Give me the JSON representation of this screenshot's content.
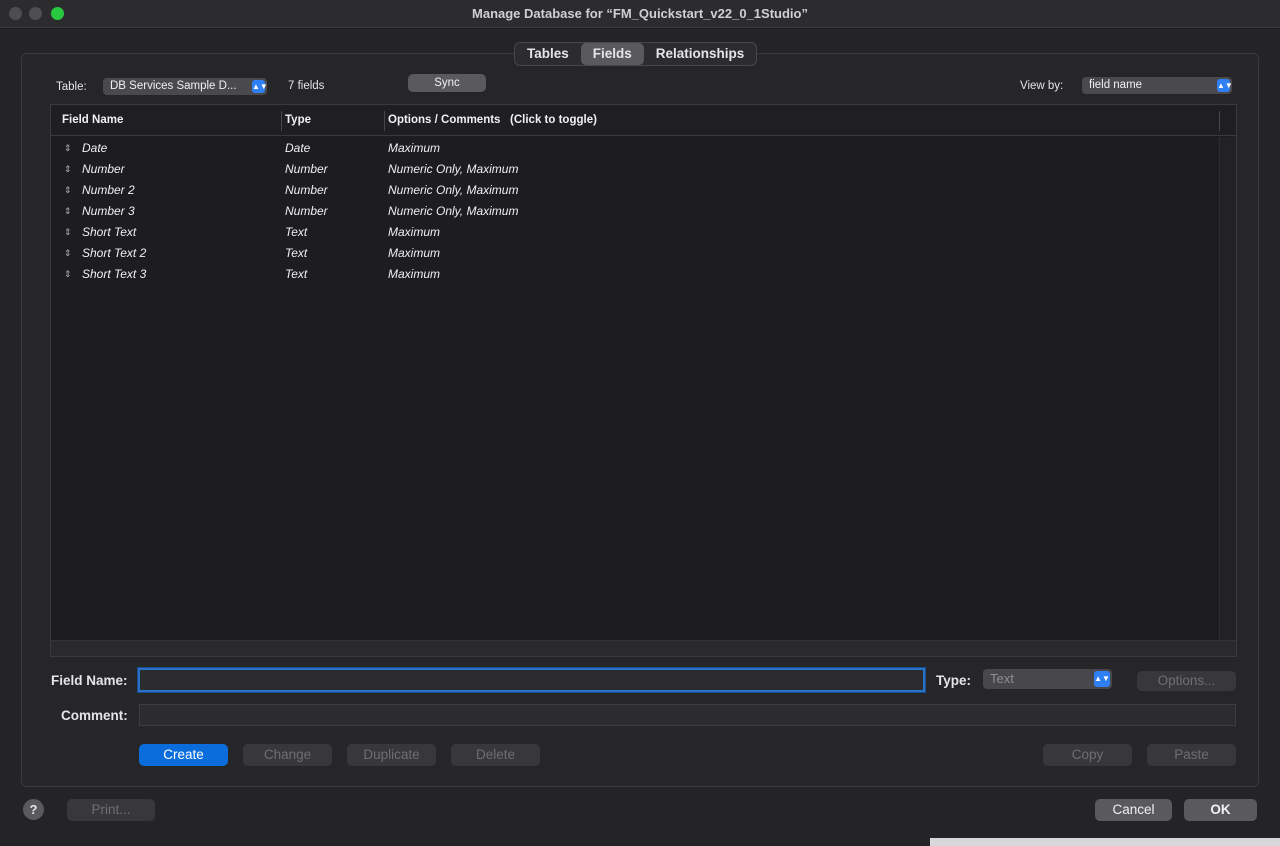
{
  "window": {
    "title": "Manage Database for “FM_Quickstart_v22_0_1Studio”"
  },
  "tabs": [
    {
      "label": "Tables",
      "active": false
    },
    {
      "label": "Fields",
      "active": true
    },
    {
      "label": "Relationships",
      "active": false
    }
  ],
  "toolbar": {
    "table_label": "Table:",
    "table_value": "DB Services Sample D...",
    "field_count": "7 fields",
    "sync_label": "Sync",
    "viewby_label": "View by:",
    "viewby_value": "field name"
  },
  "grid": {
    "columns": [
      "Field Name",
      "Type",
      "Options / Comments   (Click to toggle)"
    ],
    "rows": [
      {
        "name": "Date",
        "type": "Date",
        "options": "Maximum"
      },
      {
        "name": "Number",
        "type": "Number",
        "options": "Numeric Only, Maximum"
      },
      {
        "name": "Number 2",
        "type": "Number",
        "options": "Numeric Only, Maximum"
      },
      {
        "name": "Number 3",
        "type": "Number",
        "options": "Numeric Only, Maximum"
      },
      {
        "name": "Short Text",
        "type": "Text",
        "options": "Maximum"
      },
      {
        "name": "Short Text 2",
        "type": "Text",
        "options": "Maximum"
      },
      {
        "name": "Short Text 3",
        "type": "Text",
        "options": "Maximum"
      }
    ]
  },
  "form": {
    "field_name_label": "Field Name:",
    "field_name_value": "",
    "type_label": "Type:",
    "type_value": "Text",
    "options_label": "Options...",
    "comment_label": "Comment:",
    "comment_value": ""
  },
  "actions": {
    "create": "Create",
    "change": "Change",
    "duplicate": "Duplicate",
    "delete": "Delete",
    "copy": "Copy",
    "paste": "Paste"
  },
  "footer": {
    "help": "?",
    "print": "Print...",
    "cancel": "Cancel",
    "ok": "OK"
  },
  "colors": {
    "accent": "#0a6ddb",
    "green_light": "#28c840"
  }
}
